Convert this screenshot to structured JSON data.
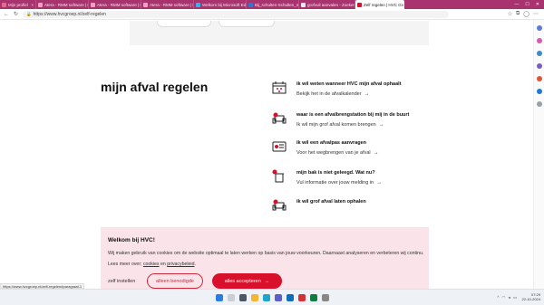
{
  "browser": {
    "tabs": [
      {
        "title": "Mijn profiel",
        "color": "#e46a8e"
      },
      {
        "title": "Atera - RMM software | PSA S",
        "color": "#f2a0c0"
      },
      {
        "title": "Atera - RMM software | PSA S",
        "color": "#f2a0c0"
      },
      {
        "title": "Atera - RMM software | PSA S",
        "color": "#f2a0c0"
      },
      {
        "title": "Welkom bij Microsoft Edge",
        "color": "#3bb0e6"
      },
      {
        "title": "Bij_schulten-Schulten_mert_su...",
        "color": "#2b79d0"
      },
      {
        "title": "grofvuil aanvalen - Zoeken",
        "color": "#e8e8e8"
      },
      {
        "title": "Zelf regelen | HVC Groep",
        "color": "#d9102b"
      }
    ],
    "active_tab_index": 7,
    "url_prefix": "https://www.hvcgroep.nl",
    "url_path": "/zelf-regelen"
  },
  "page": {
    "heading": "mijn afval regelen",
    "items": [
      {
        "title": "ik wil weten wanneer HVC mijn afval ophaalt",
        "link": "Bekijk het in de afvalkalender",
        "icon": "calendar-icon"
      },
      {
        "title": "waar is een afvalbrengstation bij mij in de buurt",
        "link": "Ik wil mijn grof afval komen brengen",
        "icon": "sofa-icon"
      },
      {
        "title": "ik wil een afvalpas aanvragen",
        "link": "Voor het wegbrengen van je afval",
        "icon": "card-icon"
      },
      {
        "title": "mijn bak is niet geleegd. Wat nu?",
        "link": "Vul informatie over jouw melding in",
        "icon": "bin-alert-icon"
      },
      {
        "title": "ik wil grof afval laten ophalen",
        "link": "",
        "icon": "sofa-icon"
      }
    ]
  },
  "cookie": {
    "title": "Welkom bij HVC!",
    "text_before": "Wij maken gebruik van cookies om de website optimaal te laten werken op basis van jouw voorkeuren. Daarnaast analyseren en verbeteren wij continu. Lees meer over; ",
    "link_cookies": "cookies",
    "text_mid": " en ",
    "link_privacy": "privacybeleid",
    "text_after": ".",
    "btn_settings": "zelf instellen",
    "btn_necessary": "alleen benodigde",
    "btn_accept": "alles accepteren"
  },
  "status_link": "https://www.hvcgroep.nl/zelf-regelen#paragraaf-1",
  "taskbar": {
    "time": "07:29",
    "date": "22-10-2024"
  },
  "colors": {
    "brand_red": "#d9102b",
    "tabstrip": "#a9336e",
    "cookie_bg": "#fbe3ea"
  }
}
